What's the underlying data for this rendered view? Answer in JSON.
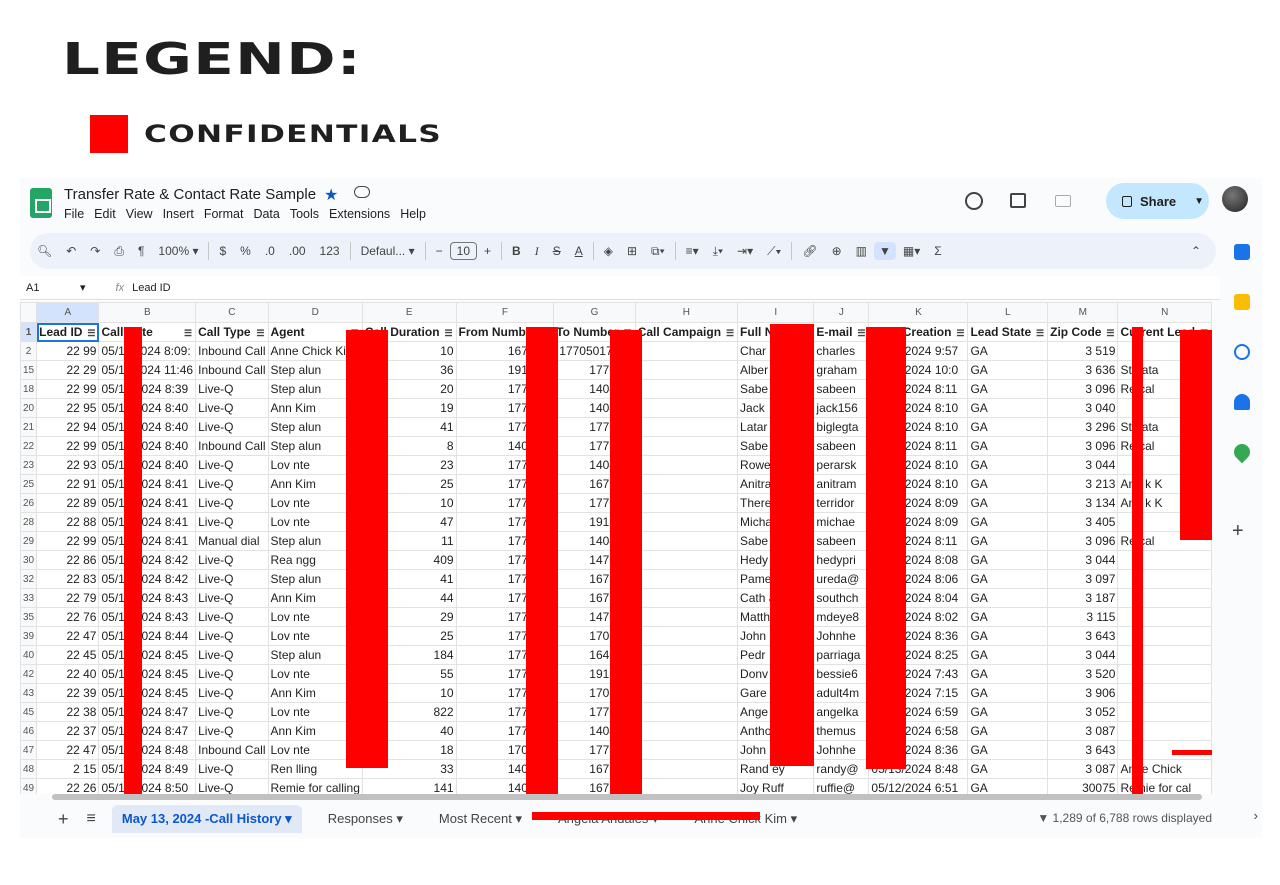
{
  "legend": {
    "title": "LEGEND:",
    "item_label": "CONFIDENTIALS",
    "item_color": "#ff0000"
  },
  "app": {
    "doc_title": "Transfer Rate & Contact Rate Sample",
    "menu": [
      "File",
      "Edit",
      "View",
      "Insert",
      "Format",
      "Data",
      "Tools",
      "Extensions",
      "Help"
    ],
    "share_label": "Share",
    "toolbar": {
      "zoom": "100%",
      "currency": "$",
      "percent": "%",
      "dec_decrease": ".0",
      "dec_increase": ".00",
      "number_format": "123",
      "font": "Defaul...",
      "minus": "−",
      "font_size": "10",
      "plus": "+",
      "bold": "B",
      "italic": "I",
      "strike": "S",
      "text_color": "A",
      "sigma": "Σ"
    },
    "name_box": "A1",
    "fx": "fx",
    "formula": "Lead ID",
    "columns": [
      "A",
      "B",
      "C",
      "D",
      "E",
      "F",
      "G",
      "H",
      "I",
      "J",
      "K",
      "L",
      "M",
      "N"
    ],
    "header_row": [
      "Lead ID",
      "Call Date",
      "Call Type",
      "Agent",
      "Call Duration",
      "From Number",
      "To Number",
      "Call Campaign",
      "Full Name",
      "E-mail",
      "Lead Creation",
      "Lead State",
      "Zip Code",
      "Current Lead"
    ],
    "rows": [
      {
        "n": "2",
        "cells": [
          "22 99",
          "05/11/2024 8:09:",
          "Inbound Call",
          "Anne Chick Kim",
          "10",
          "1678 86",
          "17705017391",
          "",
          "Char",
          "charles",
          "05/06/2024 9:57",
          "GA",
          "3 519",
          ""
        ]
      },
      {
        "n": "15",
        "cells": [
          "22 29",
          "05/11/2024 11:46",
          "Inbound Call",
          "Step alun",
          "36",
          "1912 25",
          "1770 01",
          "",
          "Alber",
          "graham",
          "05/07/2024 10:0",
          "GA",
          "3 636",
          "Ste ata"
        ]
      },
      {
        "n": "18",
        "cells": [
          "22 99",
          "05/13/2024 8:39",
          "Live-Q",
          "Step alun",
          "20",
          "1770 01",
          "1404 48",
          "",
          "Sabe ani",
          "sabeen",
          "05/13/2024 8:11",
          "GA",
          "3 096",
          "Re cal"
        ]
      },
      {
        "n": "20",
        "cells": [
          "22 95",
          "05/13/2024 8:40",
          "Live-Q",
          "Ann Kim",
          "19",
          "1770 91",
          "1404 77",
          "",
          "Jack",
          "jack156",
          "05/13/2024 8:10",
          "GA",
          "3 040",
          ""
        ]
      },
      {
        "n": "21",
        "cells": [
          "22 94",
          "05/13/2024 8:40",
          "Live-Q",
          "Step alun",
          "41",
          "1770 01",
          "1770 76",
          "",
          "Latar s",
          "biglegta",
          "05/13/2024 8:10",
          "GA",
          "3 296",
          "Ste ata"
        ]
      },
      {
        "n": "22",
        "cells": [
          "22 99",
          "05/13/2024 8:40",
          "Inbound Call",
          "Step alun",
          "8",
          "1404 48",
          "1770 01",
          "",
          "Sabe ani",
          "sabeen",
          "05/13/2024 8:11",
          "GA",
          "3 096",
          "Re cal"
        ]
      },
      {
        "n": "23",
        "cells": [
          "22 93",
          "05/13/2024 8:40",
          "Live-Q",
          "Lov nte",
          "23",
          "1770 72",
          "1404 21",
          "",
          "Rowe czy",
          "perarsk",
          "05/13/2024 8:10",
          "GA",
          "3 044",
          ""
        ]
      },
      {
        "n": "25",
        "cells": [
          "22 91",
          "05/13/2024 8:41",
          "Live-Q",
          "Ann Kim",
          "25",
          "1770 91",
          "1678 08",
          "",
          "Anitra",
          "anitram",
          "05/13/2024 8:10",
          "GA",
          "3 213",
          "Ann k K"
        ]
      },
      {
        "n": "26",
        "cells": [
          "22 89",
          "05/13/2024 8:41",
          "Live-Q",
          "Lov nte",
          "10",
          "1770 72",
          "1770 76",
          "",
          "There cra",
          "terridor",
          "05/13/2024 8:09",
          "GA",
          "3 134",
          "Ann k K"
        ]
      },
      {
        "n": "28",
        "cells": [
          "22 88",
          "05/13/2024 8:41",
          "Live-Q",
          "Lov nte",
          "47",
          "1770 72",
          "1912 29",
          "",
          "Micha",
          "michae",
          "05/13/2024 8:09",
          "GA",
          "3 405",
          ""
        ]
      },
      {
        "n": "29",
        "cells": [
          "22 99",
          "05/13/2024 8:41",
          "Manual dial",
          "Step alun",
          "11",
          "1770 01",
          "1404 48",
          "",
          "Sabe ani",
          "sabeen",
          "05/13/2024 8:11",
          "GA",
          "3 096",
          "Re cal"
        ]
      },
      {
        "n": "30",
        "cells": [
          "22 86",
          "05/13/2024 8:42",
          "Live-Q",
          "Rea ngg",
          "409",
          "1770 15",
          "1470 91",
          "",
          "Hedy",
          "hedypri",
          "05/13/2024 8:08",
          "GA",
          "3 044",
          ""
        ]
      },
      {
        "n": "32",
        "cells": [
          "22 83",
          "05/13/2024 8:42",
          "Live-Q",
          "Step alun",
          "41",
          "1770 01",
          "1678 86",
          "",
          "Pame",
          "ureda@",
          "05/13/2024 8:06",
          "GA",
          "3 097",
          ""
        ]
      },
      {
        "n": "33",
        "cells": [
          "22 79",
          "05/13/2024 8:43",
          "Live-Q",
          "Ann Kim",
          "44",
          "1770 91",
          "1678 72",
          "",
          "Cath ani",
          "southch",
          "05/13/2024 8:04",
          "GA",
          "3 187",
          ""
        ]
      },
      {
        "n": "35",
        "cells": [
          "22 76",
          "05/13/2024 8:43",
          "Live-Q",
          "Lov nte",
          "29",
          "1770 72",
          "1470 07",
          "",
          "Matth",
          "mdeye8",
          "05/13/2024 8:02",
          "GA",
          "3 115",
          ""
        ]
      },
      {
        "n": "39",
        "cells": [
          "22 47",
          "05/13/2024 8:44",
          "Live-Q",
          "Lov nte",
          "25",
          "1770 72",
          "1706 43",
          "",
          "John",
          "Johnhe",
          "05/12/2024 8:36",
          "GA",
          "3 643",
          ""
        ]
      },
      {
        "n": "40",
        "cells": [
          "22 45",
          "05/13/2024 8:45",
          "Live-Q",
          "Step alun",
          "184",
          "1770 01",
          "1640 39",
          "",
          "Pedr",
          "parriaga",
          "05/12/2024 8:25",
          "GA",
          "3 044",
          ""
        ]
      },
      {
        "n": "42",
        "cells": [
          "22 40",
          "05/13/2024 8:45",
          "Live-Q",
          "Lov nte",
          "55",
          "1770 72",
          "1912 35",
          "",
          "Donv",
          "bessie6",
          "05/12/2024 7:43",
          "GA",
          "3 520",
          ""
        ]
      },
      {
        "n": "43",
        "cells": [
          "22 39",
          "05/13/2024 8:45",
          "Live-Q",
          "Ann Kim",
          "10",
          "1770 91",
          "1706 52",
          "",
          "Gare",
          "adult4m",
          "05/12/2024 7:15",
          "GA",
          "3 906",
          ""
        ]
      },
      {
        "n": "45",
        "cells": [
          "22 38",
          "05/13/2024 8:47",
          "Live-Q",
          "Lov nte",
          "822",
          "1770 72",
          "1770 77",
          "",
          "Ange",
          "angelka",
          "05/12/2024 6:59",
          "GA",
          "3 052",
          ""
        ]
      },
      {
        "n": "46",
        "cells": [
          "22 37",
          "05/13/2024 8:47",
          "Live-Q",
          "Ann Kim",
          "40",
          "1770 91",
          "1404 15",
          "",
          "Antho ey",
          "themus",
          "05/12/2024 6:58",
          "GA",
          "3 087",
          ""
        ]
      },
      {
        "n": "47",
        "cells": [
          "22 47",
          "05/13/2024 8:48",
          "Inbound Call",
          "Lov nte",
          "18",
          "1706 43",
          "1770 72",
          "",
          "John",
          "Johnhe",
          "05/12/2024 8:36",
          "GA",
          "3 643",
          ""
        ]
      },
      {
        "n": "48",
        "cells": [
          "2 15",
          "05/13/2024 8:49",
          "Live-Q",
          "Ren lling",
          "33",
          "1404 80",
          "1678 65",
          "",
          "Rand ey",
          "randy@",
          "05/13/2024 8:48",
          "GA",
          "3 087",
          "Anne Chick"
        ]
      },
      {
        "n": "49",
        "cells": [
          "22 26",
          "05/13/2024 8:50",
          "Live-Q",
          "Remie for calling",
          "141",
          "1404 80",
          "1678 80",
          "",
          "Joy Ruff",
          "ruffie@",
          "05/12/2024 6:51",
          "GA",
          "30075",
          "Remie for cal"
        ]
      }
    ],
    "tabs": [
      "May 13, 2024 -Call History",
      "Responses",
      "Most Recent",
      "Angela Andales",
      "Anne Chick Kim"
    ],
    "row_count": "1,289 of 6,788 rows displayed"
  }
}
